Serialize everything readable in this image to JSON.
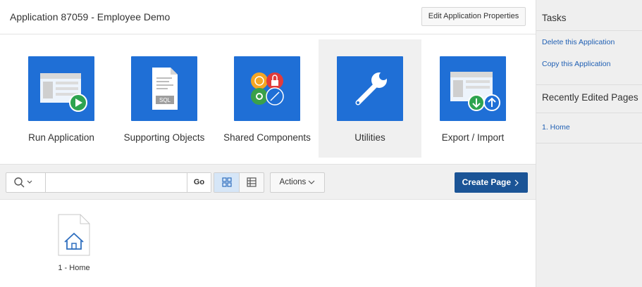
{
  "header": {
    "app_title": "Application 87059 - Employee Demo",
    "edit_properties_label": "Edit Application Properties"
  },
  "tiles": [
    {
      "label": "Run Application",
      "icon": "run-application-icon"
    },
    {
      "label": "Supporting Objects",
      "icon": "supporting-objects-icon",
      "badge": "SQL"
    },
    {
      "label": "Shared Components",
      "icon": "shared-components-icon"
    },
    {
      "label": "Utilities",
      "icon": "wrench-icon"
    },
    {
      "label": "Export / Import",
      "icon": "export-import-icon"
    }
  ],
  "toolbar": {
    "search_value": "",
    "search_placeholder": "",
    "go_label": "Go",
    "actions_label": "Actions",
    "create_page_label": "Create Page"
  },
  "pages": [
    {
      "label": "1 - Home",
      "icon": "home-page-icon"
    }
  ],
  "side": {
    "tasks_heading": "Tasks",
    "task_links": [
      "Delete this Application",
      "Copy this Application"
    ],
    "recent_heading": "Recently Edited Pages",
    "recent_pages": [
      "1. Home"
    ]
  },
  "colors": {
    "tile_blue": "#1f6fd6",
    "primary_button": "#1b5496",
    "link_blue": "#1f5fb3",
    "side_panel_bg": "#efefef"
  }
}
